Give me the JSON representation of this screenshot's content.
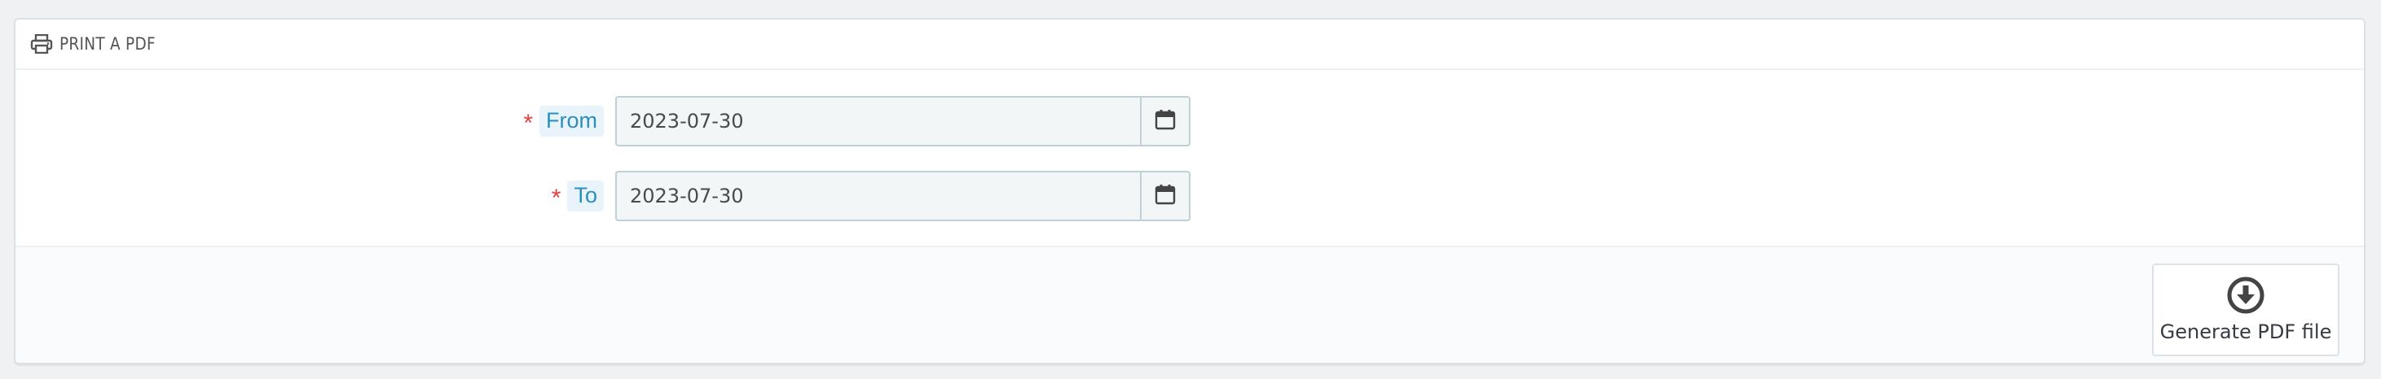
{
  "panel": {
    "title": "PRINT A PDF",
    "title_icon": "printer-icon"
  },
  "form": {
    "from": {
      "required_marker": "*",
      "label": "From",
      "value": "2023-07-30",
      "calendar_icon": "calendar-icon"
    },
    "to": {
      "required_marker": "*",
      "label": "To",
      "value": "2023-07-30",
      "calendar_icon": "calendar-icon"
    }
  },
  "footer": {
    "generate_label": "Generate PDF file",
    "generate_icon": "download-circle-icon"
  },
  "colors": {
    "label_text": "#2a8fbd",
    "label_bg": "#e8f4fa",
    "required": "#e04040",
    "input_bg": "#f3f6f7",
    "input_border": "#bdd1d6"
  }
}
